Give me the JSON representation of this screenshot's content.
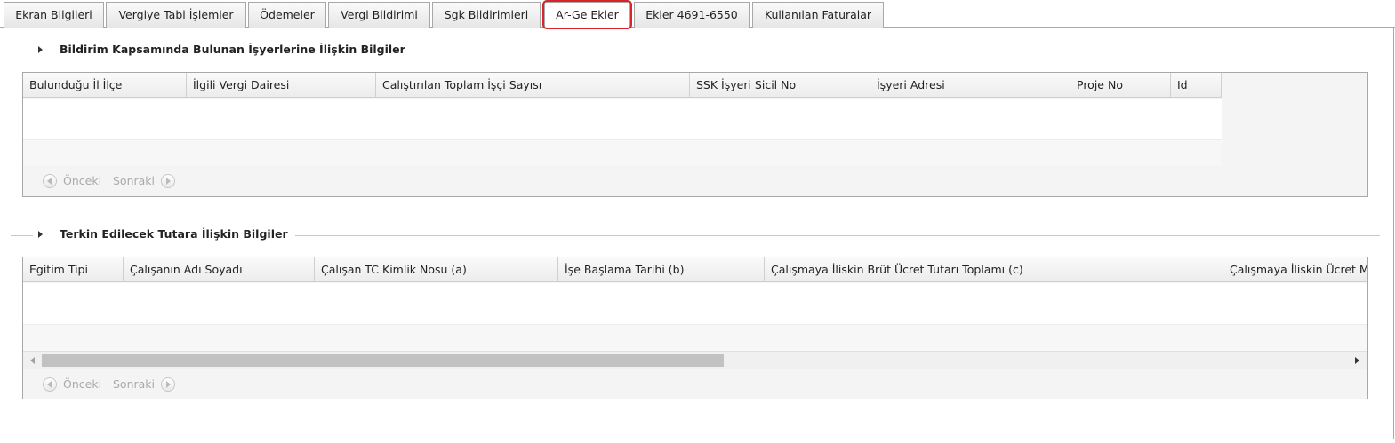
{
  "tabs": [
    {
      "label": "Ekran Bilgileri",
      "active": false
    },
    {
      "label": "Vergiye Tabi İşlemler",
      "active": false
    },
    {
      "label": "Ödemeler",
      "active": false
    },
    {
      "label": "Vergi Bildirimi",
      "active": false
    },
    {
      "label": "Sgk Bildirimleri",
      "active": false
    },
    {
      "label": "Ar-Ge Ekler",
      "active": true
    },
    {
      "label": "Ekler 4691-6550",
      "active": false
    },
    {
      "label": "Kullanılan Faturalar",
      "active": false
    }
  ],
  "section1": {
    "title": "Bildirim Kapsamında Bulunan İşyerlerine İlişkin Bilgiler",
    "columns": [
      "Bulunduğu İl İlçe",
      "İlgili Vergi Dairesi",
      "Calıştırılan Toplam İşçi Sayısı",
      "SSK İşyeri Sicil No",
      "İşyeri Adresi",
      "Proje No",
      "Id"
    ],
    "pager": {
      "prev": "Önceki",
      "next": "Sonraki"
    }
  },
  "section2": {
    "title": "Terkin Edilecek Tutara İlişkin Bilgiler",
    "columns": [
      "Egitim Tipi",
      "Çalışanın Adı Soyadı",
      "Çalışan TC Kimlik Nosu (a)",
      "İşe Başlama Tarihi (b)",
      "Çalışmaya İliskin Brüt Ücret Tutarı Toplamı (c)",
      "Çalışmaya İliskin Ücret M"
    ],
    "pager": {
      "prev": "Önceki",
      "next": "Sonraki"
    }
  },
  "colors": {
    "active_tab_highlight": "#d6262b",
    "border": "#a8a8a8"
  }
}
